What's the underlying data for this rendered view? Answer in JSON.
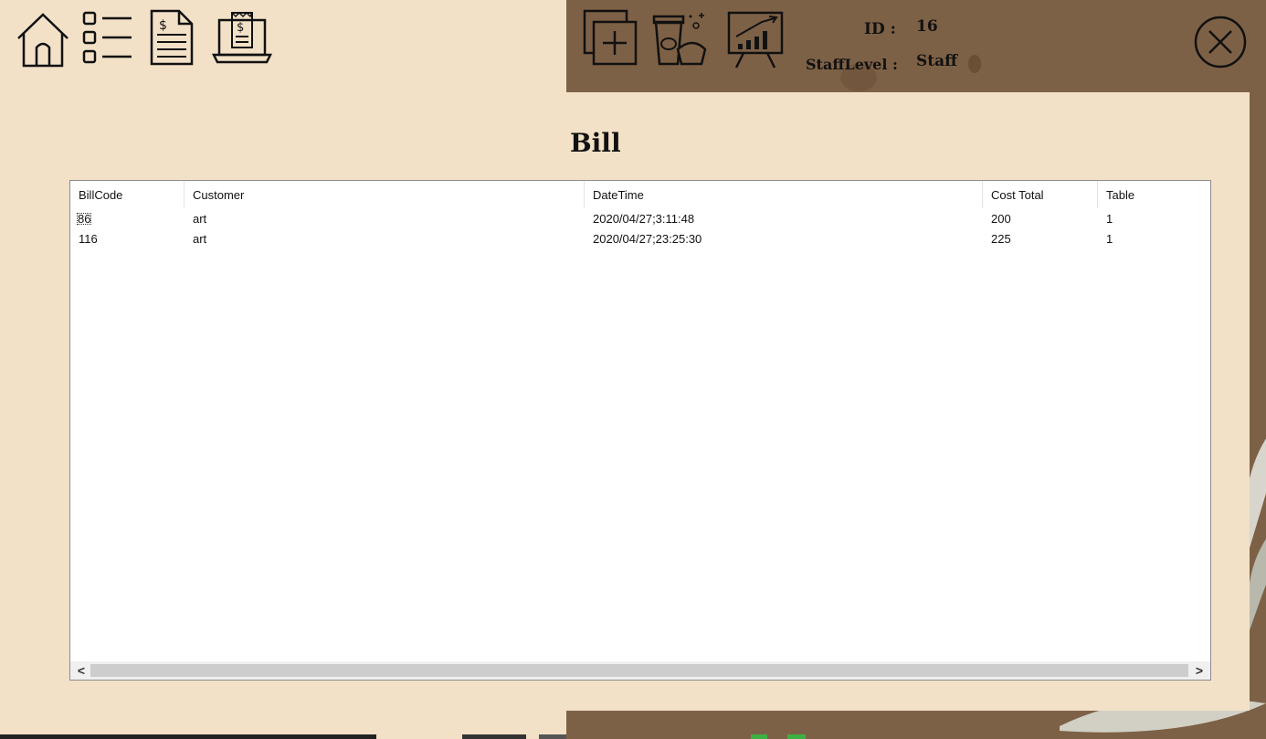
{
  "header": {
    "icons": {
      "home": "home-icon",
      "list": "list-icon",
      "document": "bill-document-icon",
      "receipt": "receipt-laptop-icon",
      "add": "add-window-icon",
      "menu": "coffee-dessert-icon",
      "report": "chart-board-icon",
      "close": "close-icon"
    },
    "id_label": "ID :",
    "id_value": "16",
    "level_label": "StaffLevel :",
    "level_value": "Staff"
  },
  "main": {
    "title": "Bill",
    "table": {
      "columns": [
        "BillCode",
        "Customer",
        "DateTime",
        "Cost Total",
        "Table"
      ],
      "rows": [
        [
          "86",
          "art",
          "2020/04/27;3:11:48",
          "200",
          "1"
        ],
        [
          "116",
          "art",
          "2020/04/27;23:25:30",
          "225",
          "1"
        ]
      ]
    },
    "scrollbar": {
      "left_arrow": "<",
      "right_arrow": ">"
    }
  },
  "colors": {
    "background": "#f2e1c7",
    "backdrop": "#7d6146",
    "table_bg": "#ffffff"
  }
}
